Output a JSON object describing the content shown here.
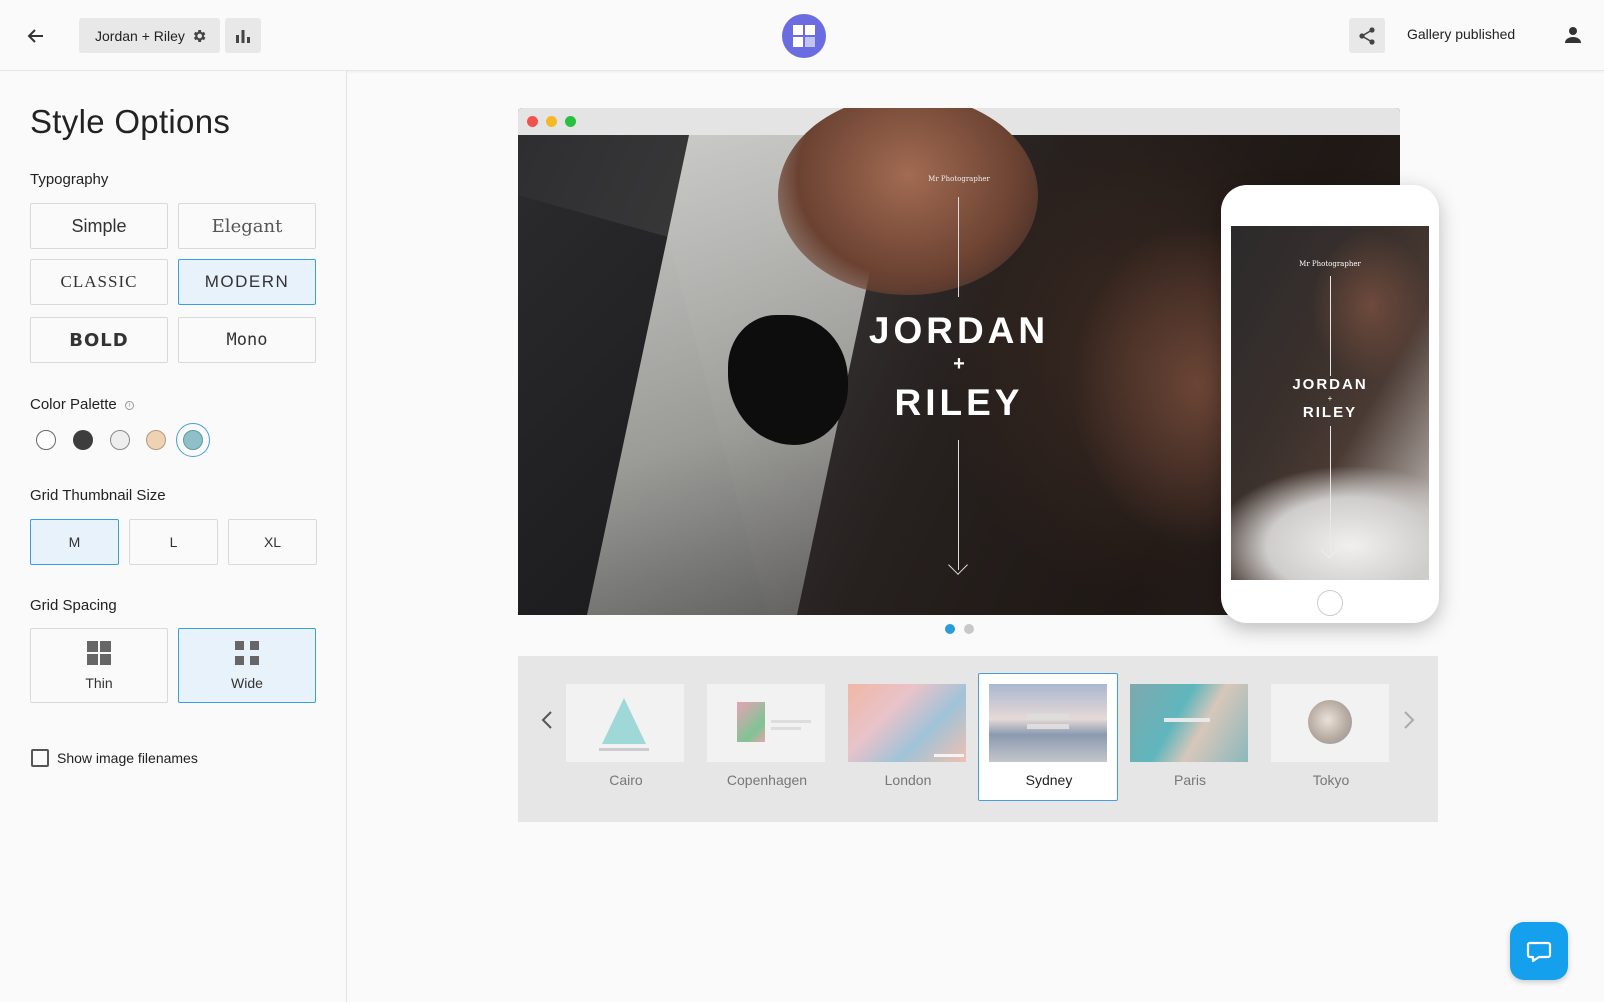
{
  "header": {
    "gallery_name": "Jordan + Riley",
    "status": "Gallery published",
    "icons": [
      "back-arrow-icon",
      "gear-icon",
      "bar-chart-icon",
      "app-logo-icon",
      "share-icon",
      "user-icon"
    ]
  },
  "sidebar": {
    "title": "Style Options",
    "typography": {
      "label": "Typography",
      "options": [
        "Simple",
        "Elegant",
        "CLASSIC",
        "MODERN",
        "BOLD",
        "Mono"
      ],
      "selected": "MODERN"
    },
    "color_palette": {
      "label": "Color Palette",
      "swatches": [
        "#ffffff",
        "#3d3d3d",
        "#eeeeee",
        "#efd2b3",
        "#8fc0c8"
      ],
      "selected_index": 4
    },
    "grid_thumbnail_size": {
      "label": "Grid Thumbnail Size",
      "options": [
        "M",
        "L",
        "XL"
      ],
      "selected": "M"
    },
    "grid_spacing": {
      "label": "Grid Spacing",
      "options": [
        "Thin",
        "Wide"
      ],
      "selected": "Wide"
    },
    "show_filenames": {
      "label": "Show image filenames",
      "checked": false
    }
  },
  "preview": {
    "credit": "Mr Photographer",
    "name1": "JORDAN",
    "plus": "+",
    "name2": "RILEY",
    "pager": {
      "count": 2,
      "active": 1
    }
  },
  "themes": {
    "items": [
      "Cairo",
      "Copenhagen",
      "London",
      "Sydney",
      "Paris",
      "Tokyo"
    ],
    "selected": "Sydney"
  },
  "colors": {
    "accent": "#3aa0dc",
    "selected_bg": "#e8f2fb",
    "logo": "#6b6ce0",
    "chat": "#14a0ec"
  }
}
